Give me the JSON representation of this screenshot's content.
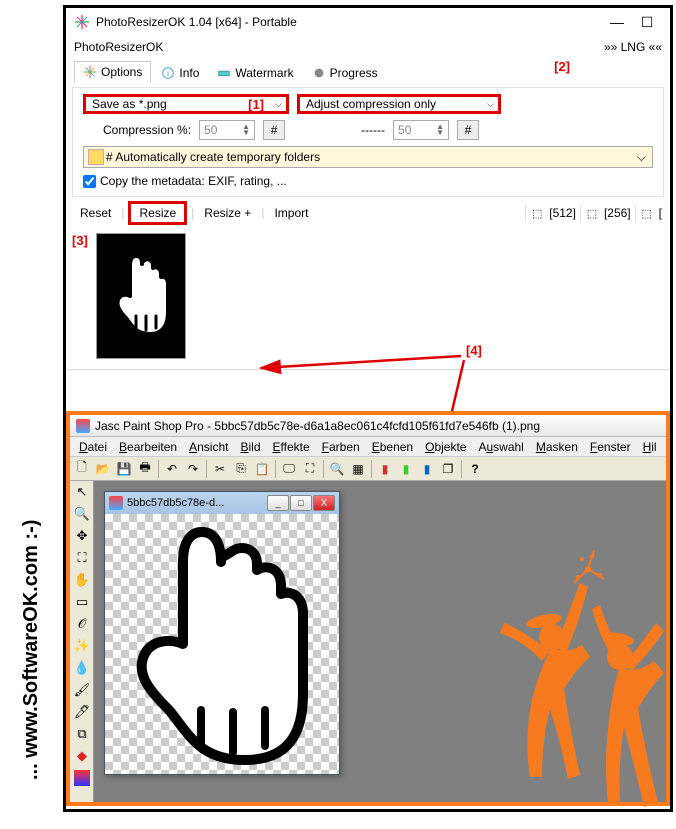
{
  "watermark": "... www.SoftwareOK.com :-)",
  "win1": {
    "title": "PhotoResizerOK 1.04 [x64] - Portable",
    "menu_left": "PhotoResizerOK",
    "menu_right": "»» LNG ««",
    "tabs": {
      "options": "Options",
      "info": "Info",
      "watermark": "Watermark",
      "progress": "Progress"
    },
    "annotations": {
      "a1": "[1]",
      "a2": "[2]",
      "a3": "[3]",
      "a4": "[4]"
    },
    "save_as": "Save as *.png",
    "adjust": "Adjust compression only",
    "compression_label": "Compression %:",
    "compression_val": "50",
    "dash": "------",
    "spinner2_val": "50",
    "hash": "#",
    "tempfolder": "# Automatically create temporary folders",
    "copymeta": "Copy the metadata: EXIF, rating, ...",
    "toolbar": {
      "reset": "Reset",
      "resize": "Resize",
      "resizeplus": "Resize +",
      "import": "Import",
      "preset512": "[512]",
      "preset256": "[256]",
      "presetX": "["
    }
  },
  "win2": {
    "title": "Jasc Paint Shop Pro - 5bbc57db5c78e-d6a1a8ec061c4fcfd105f61fd7e546fb (1).png",
    "menu": [
      "Datei",
      "Bearbeiten",
      "Ansicht",
      "Bild",
      "Effekte",
      "Farben",
      "Ebenen",
      "Objekte",
      "Auswahl",
      "Masken",
      "Fenster",
      "Hil"
    ],
    "doc_title": "5bbc57db5c78e-d...",
    "close_x": "X",
    "min": "_",
    "max": "□"
  }
}
